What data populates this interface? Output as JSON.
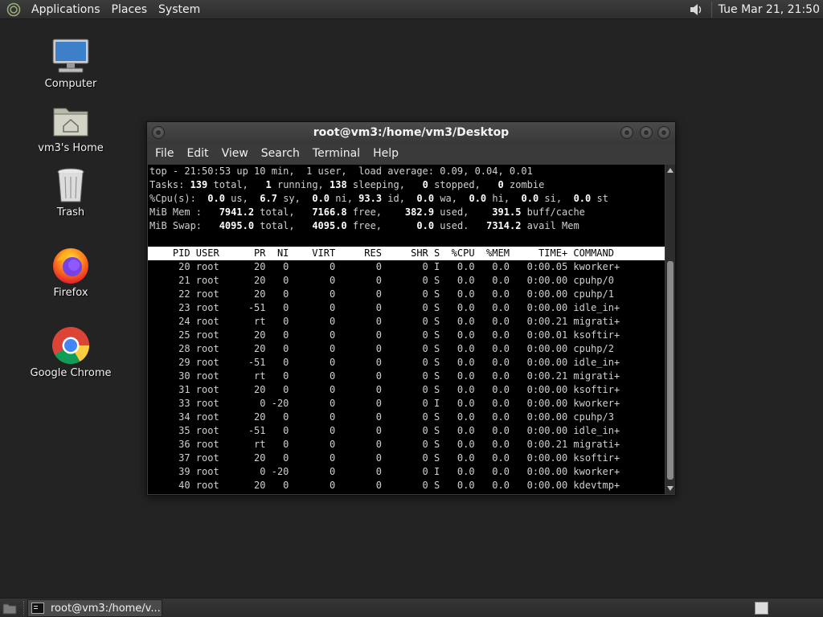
{
  "top_panel": {
    "menus": [
      "Applications",
      "Places",
      "System"
    ],
    "clock": "Tue Mar 21, 21:50"
  },
  "desktop": {
    "icons": [
      {
        "label": "Computer",
        "icon": "computer-icon"
      },
      {
        "label": "vm3's Home",
        "icon": "home-folder-icon"
      },
      {
        "label": "Trash",
        "icon": "trash-icon"
      },
      {
        "label": "Firefox",
        "icon": "firefox-icon"
      },
      {
        "label": "Google Chrome",
        "icon": "chrome-icon"
      }
    ]
  },
  "terminal": {
    "title": "root@vm3:/home/vm3/Desktop",
    "menu": [
      "File",
      "Edit",
      "View",
      "Search",
      "Terminal",
      "Help"
    ],
    "summary": {
      "line1": "top - 21:50:53 up 10 min,  1 user,  load average: 0.09, 0.04, 0.01",
      "tasks": {
        "total": "139",
        "running": "1",
        "sleeping": "138",
        "stopped": "0",
        "zombie": "0"
      },
      "cpu": {
        "us": "0.0",
        "sy": "6.7",
        "ni": "0.0",
        "id": "93.3",
        "wa": "0.0",
        "hi": "0.0",
        "si": "0.0",
        "st": "0.0"
      },
      "mem": {
        "total": "7941.2",
        "free": "7166.8",
        "used": "382.9",
        "buff_cache": "391.5"
      },
      "swap": {
        "total": "4095.0",
        "free": "4095.0",
        "used": "0.0",
        "avail_mem": "7314.2"
      }
    },
    "columns": [
      "PID",
      "USER",
      "PR",
      "NI",
      "VIRT",
      "RES",
      "SHR",
      "S",
      "%CPU",
      "%MEM",
      "TIME+",
      "COMMAND"
    ],
    "processes": [
      [
        "20",
        "root",
        "20",
        "0",
        "0",
        "0",
        "0",
        "I",
        "0.0",
        "0.0",
        "0:00.05",
        "kworker+"
      ],
      [
        "21",
        "root",
        "20",
        "0",
        "0",
        "0",
        "0",
        "S",
        "0.0",
        "0.0",
        "0:00.00",
        "cpuhp/0"
      ],
      [
        "22",
        "root",
        "20",
        "0",
        "0",
        "0",
        "0",
        "S",
        "0.0",
        "0.0",
        "0:00.00",
        "cpuhp/1"
      ],
      [
        "23",
        "root",
        "-51",
        "0",
        "0",
        "0",
        "0",
        "S",
        "0.0",
        "0.0",
        "0:00.00",
        "idle_in+"
      ],
      [
        "24",
        "root",
        "rt",
        "0",
        "0",
        "0",
        "0",
        "S",
        "0.0",
        "0.0",
        "0:00.21",
        "migrati+"
      ],
      [
        "25",
        "root",
        "20",
        "0",
        "0",
        "0",
        "0",
        "S",
        "0.0",
        "0.0",
        "0:00.01",
        "ksoftir+"
      ],
      [
        "28",
        "root",
        "20",
        "0",
        "0",
        "0",
        "0",
        "S",
        "0.0",
        "0.0",
        "0:00.00",
        "cpuhp/2"
      ],
      [
        "29",
        "root",
        "-51",
        "0",
        "0",
        "0",
        "0",
        "S",
        "0.0",
        "0.0",
        "0:00.00",
        "idle_in+"
      ],
      [
        "30",
        "root",
        "rt",
        "0",
        "0",
        "0",
        "0",
        "S",
        "0.0",
        "0.0",
        "0:00.21",
        "migrati+"
      ],
      [
        "31",
        "root",
        "20",
        "0",
        "0",
        "0",
        "0",
        "S",
        "0.0",
        "0.0",
        "0:00.00",
        "ksoftir+"
      ],
      [
        "33",
        "root",
        "0",
        "-20",
        "0",
        "0",
        "0",
        "I",
        "0.0",
        "0.0",
        "0:00.00",
        "kworker+"
      ],
      [
        "34",
        "root",
        "20",
        "0",
        "0",
        "0",
        "0",
        "S",
        "0.0",
        "0.0",
        "0:00.00",
        "cpuhp/3"
      ],
      [
        "35",
        "root",
        "-51",
        "0",
        "0",
        "0",
        "0",
        "S",
        "0.0",
        "0.0",
        "0:00.00",
        "idle_in+"
      ],
      [
        "36",
        "root",
        "rt",
        "0",
        "0",
        "0",
        "0",
        "S",
        "0.0",
        "0.0",
        "0:00.21",
        "migrati+"
      ],
      [
        "37",
        "root",
        "20",
        "0",
        "0",
        "0",
        "0",
        "S",
        "0.0",
        "0.0",
        "0:00.00",
        "ksoftir+"
      ],
      [
        "39",
        "root",
        "0",
        "-20",
        "0",
        "0",
        "0",
        "I",
        "0.0",
        "0.0",
        "0:00.00",
        "kworker+"
      ],
      [
        "40",
        "root",
        "20",
        "0",
        "0",
        "0",
        "0",
        "S",
        "0.0",
        "0.0",
        "0:00.00",
        "kdevtmp+"
      ]
    ]
  },
  "taskbar": {
    "tasks": [
      "root@vm3:/home/v..."
    ]
  },
  "colors": {
    "desktop_bg": "#232323",
    "panel_bg": "#333333",
    "terminal_bg": "#000000",
    "terminal_fg": "#d0d0d0",
    "header_bg": "#ffffff"
  }
}
